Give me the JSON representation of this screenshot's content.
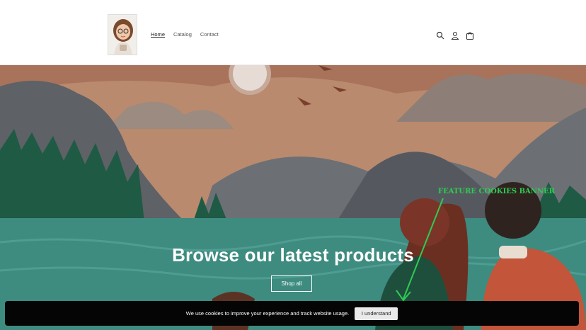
{
  "nav": {
    "items": [
      {
        "label": "Home"
      },
      {
        "label": "Catalog"
      },
      {
        "label": "Contact"
      }
    ]
  },
  "header_icons": [
    "search-icon",
    "account-icon",
    "cart-icon"
  ],
  "hero": {
    "title": "Browse our latest products",
    "button_label": "Shop all"
  },
  "annotation": {
    "text": "FEATURE COOKIES BANNER",
    "color": "#2ecc51"
  },
  "cookie_banner": {
    "text": "We use cookies to improve your experience and track website usage.",
    "button_label": "I understand"
  },
  "colors": {
    "sky": "#b98a6e",
    "water": "#3e8b80",
    "banner": "#050505"
  }
}
